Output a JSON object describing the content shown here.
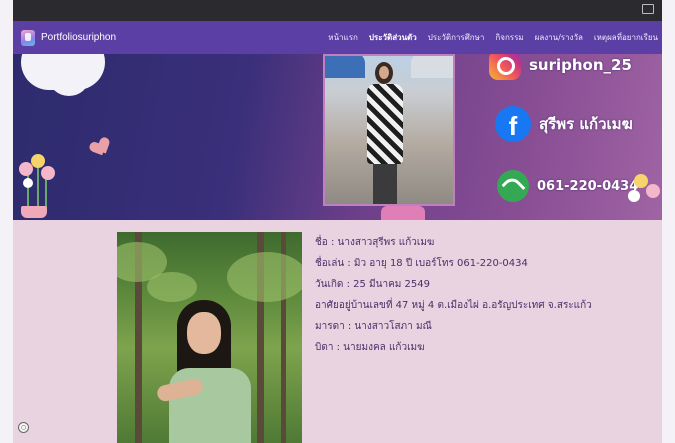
{
  "brand": {
    "name": "Portfoliosuriphon"
  },
  "nav": {
    "items": [
      {
        "label": "หน้าแรก",
        "active": false
      },
      {
        "label": "ประวัติส่วนตัว",
        "active": true
      },
      {
        "label": "ประวัติการศึกษา",
        "active": false
      },
      {
        "label": "กิจกรรม",
        "active": false
      },
      {
        "label": "ผลงาน/รางวัล",
        "active": false
      },
      {
        "label": "เหตุผลที่อยากเรียน",
        "active": false
      }
    ]
  },
  "hero": {
    "instagram": "suriphon_25",
    "facebook": "สุรีพร แก้วเมฆ",
    "phone": "061-220-0434"
  },
  "about": {
    "lines": [
      "ชื่อ : นางสาวสุรีพร แก้วเมฆ",
      "ชื่อเล่น : มิว อายุ 18 ปี  เบอร์โทร 061-220-0434",
      "วันเกิด : 25 มีนาคม 2549",
      "อาศัยอยู่บ้านเลขที่ 47 หมู่ 4 ต.เมืองไผ่ อ.อรัญประเทศ จ.สระแก้ว",
      "มารดา : นางสาวโสภา มณี",
      "บิดา : นายมงคล แก้วเมฆ"
    ]
  },
  "colors": {
    "navbar": "#5b3fa4",
    "about_bg": "#e9d3e1",
    "text": "#4b2f68"
  }
}
